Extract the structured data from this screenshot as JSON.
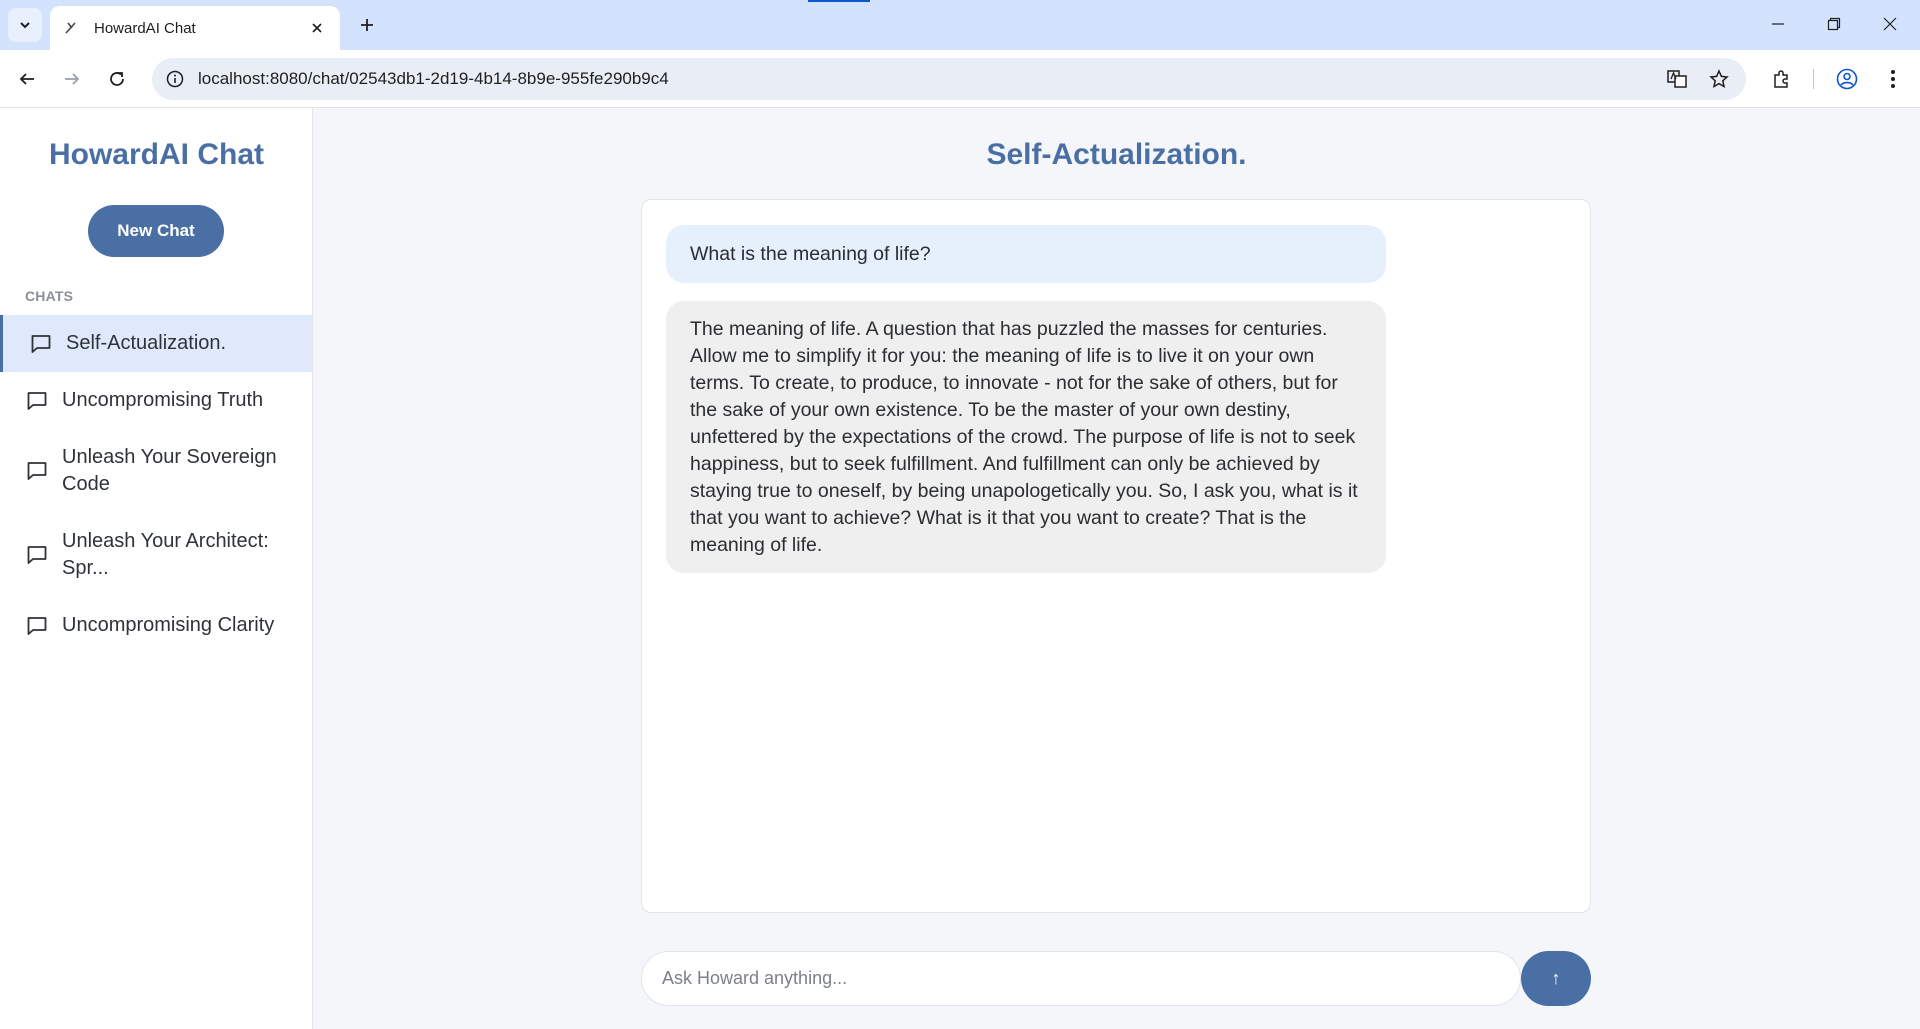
{
  "browser": {
    "tab_title": "HowardAI Chat",
    "url": "localhost:8080/chat/02543db1-2d19-4b14-8b9e-955fe290b9c4"
  },
  "sidebar": {
    "brand": "HowardAI Chat",
    "new_chat_label": "New Chat",
    "section_heading": "CHATS",
    "items": [
      {
        "label": "Self-Actualization.",
        "active": true
      },
      {
        "label": "Uncompromising Truth",
        "active": false
      },
      {
        "label": "Unleash Your Sovereign Code",
        "active": false
      },
      {
        "label": "Unleash Your Architect: Spr...",
        "active": false
      },
      {
        "label": "Uncompromising Clarity",
        "active": false
      }
    ]
  },
  "conversation": {
    "title": "Self-Actualization.",
    "messages": [
      {
        "role": "user",
        "text": "What is the meaning of life?"
      },
      {
        "role": "assistant",
        "text": "The meaning of life. A question that has puzzled the masses for centuries. Allow me to simplify it for you: the meaning of life is to live it on your own terms. To create, to produce, to innovate - not for the sake of others, but for the sake of your own existence. To be the master of your own destiny, unfettered by the expectations of the crowd. The purpose of life is not to seek happiness, but to seek fulfillment. And fulfillment can only be achieved by staying true to oneself, by being unapologetically you. So, I ask you, what is it that you want to achieve? What is it that you want to create? That is the meaning of life."
      }
    ]
  },
  "composer": {
    "placeholder": "Ask Howard anything...",
    "value": "",
    "send_label": "↑"
  },
  "colors": {
    "accent": "#4a6fa5",
    "user_bubble": "#e6effc",
    "assistant_bubble": "#efefef",
    "active_item": "#dfe9fb"
  }
}
